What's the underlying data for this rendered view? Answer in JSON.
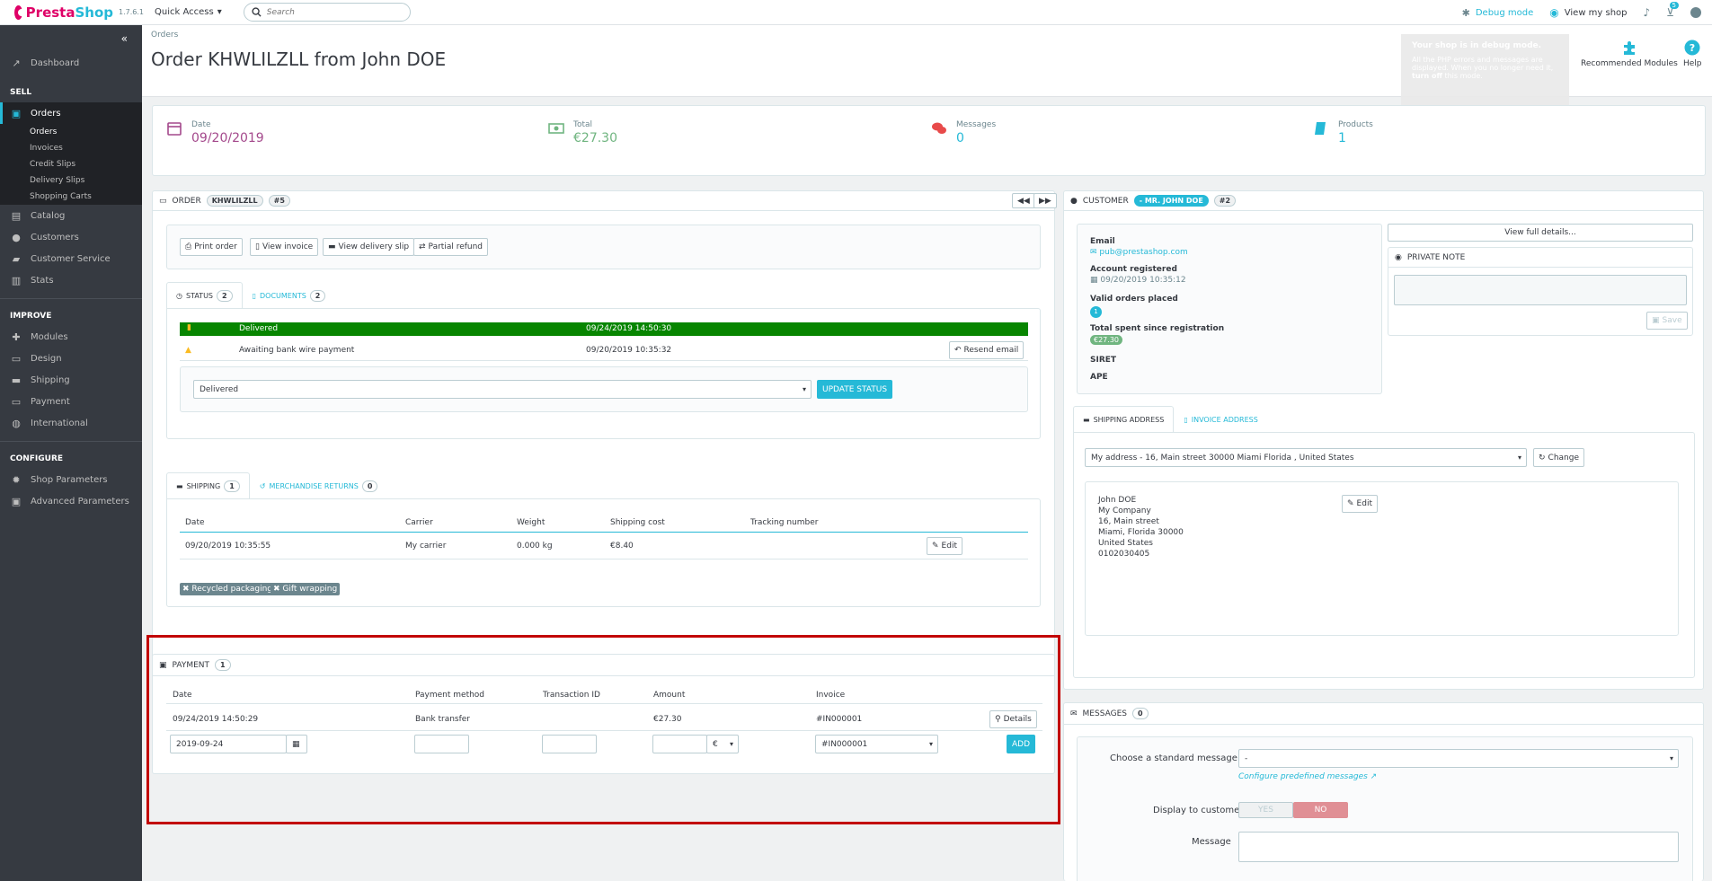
{
  "app": {
    "brand_pre": "Presta",
    "brand_post": "Shop",
    "version": "1.7.6.1",
    "quick_access": "Quick Access",
    "search_placeholder": "Search"
  },
  "topnav": {
    "debug_mode": "Debug mode",
    "view_shop": "View my shop",
    "notif_count": "5"
  },
  "debug_popup": {
    "title": "Your shop is in debug mode.",
    "body": "All the PHP errors and messages are displayed. When you no longer need it, ",
    "turn_off": "turn off",
    "body_end": " this mode."
  },
  "toolbar": {
    "recommended": "Recommended Modules",
    "help": "Help"
  },
  "sidebar": {
    "dashboard": "Dashboard",
    "sell": "SELL",
    "orders": "Orders",
    "sub": [
      "Orders",
      "Invoices",
      "Credit Slips",
      "Delivery Slips",
      "Shopping Carts"
    ],
    "catalog": "Catalog",
    "customers": "Customers",
    "customer_service": "Customer Service",
    "stats": "Stats",
    "improve": "IMPROVE",
    "modules": "Modules",
    "design": "Design",
    "shipping": "Shipping",
    "payment": "Payment",
    "international": "International",
    "configure": "CONFIGURE",
    "shop_params": "Shop Parameters",
    "adv_params": "Advanced Parameters"
  },
  "page": {
    "breadcrumb": "Orders",
    "title": "Order KHWLILZLL from John DOE"
  },
  "kpis": {
    "date_label": "Date",
    "date_value": "09/20/2019",
    "total_label": "Total",
    "total_value": "€27.30",
    "messages_label": "Messages",
    "messages_value": "0",
    "products_label": "Products",
    "products_value": "1"
  },
  "order": {
    "label": "ORDER",
    "reference": "KHWLILZLL",
    "id": "#5",
    "print": "Print order",
    "view_invoice": "View invoice",
    "view_delivery": "View delivery slip",
    "partial_refund": "Partial refund",
    "tab_status": "STATUS",
    "tab_status_count": "2",
    "tab_documents": "DOCUMENTS",
    "tab_documents_count": "2",
    "status_rows": [
      {
        "name": "Delivered",
        "date": "09/24/2019 14:50:30"
      },
      {
        "name": "Awaiting bank wire payment",
        "date": "09/20/2019 10:35:32"
      }
    ],
    "resend_email": "Resend email",
    "status_select": "Delivered",
    "update_status": "UPDATE STATUS",
    "tab_shipping": "SHIPPING",
    "tab_shipping_count": "1",
    "tab_returns": "MERCHANDISE RETURNS",
    "tab_returns_count": "0",
    "ship_headers": [
      "Date",
      "Carrier",
      "Weight",
      "Shipping cost",
      "Tracking number"
    ],
    "ship_row": [
      "09/20/2019 10:35:55",
      "My carrier",
      "0.000 kg",
      "€8.40"
    ],
    "edit": "Edit",
    "recycled": "Recycled packaging",
    "gift": "Gift wrapping"
  },
  "payment": {
    "label": "PAYMENT",
    "count": "1",
    "headers": [
      "Date",
      "Payment method",
      "Transaction ID",
      "Amount",
      "Invoice"
    ],
    "row": [
      "09/24/2019 14:50:29",
      "Bank transfer",
      "",
      "€27.30",
      "#IN000001"
    ],
    "details": "Details",
    "new_date": "2019-09-24",
    "currency": "€",
    "invoice_select": "#IN000001",
    "add": "ADD"
  },
  "customer": {
    "label": "CUSTOMER",
    "name": "- MR. JOHN DOE",
    "id": "#2",
    "email_label": "Email",
    "email": "pub@prestashop.com",
    "registered_label": "Account registered",
    "registered": "09/20/2019 10:35:12",
    "valid_orders_label": "Valid orders placed",
    "valid_orders": "1",
    "total_spent_label": "Total spent since registration",
    "total_spent": "€27.30",
    "siret": "SIRET",
    "ape": "APE",
    "view_full": "View full details...",
    "private_note": "PRIVATE NOTE",
    "save": "Save",
    "tab_shipping_addr": "SHIPPING ADDRESS",
    "tab_invoice_addr": "INVOICE ADDRESS",
    "address_select": "My address - 16, Main street 30000 Miami Florida , United States",
    "change": "Change",
    "address_lines": [
      "John DOE",
      "My Company",
      "16, Main street",
      "Miami, Florida 30000",
      "United States",
      "0102030405"
    ],
    "edit": "Edit"
  },
  "messages": {
    "label": "MESSAGES",
    "count": "0",
    "choose_label": "Choose a standard message",
    "choose_value": "-",
    "configure_link": "Configure predefined messages",
    "display_label": "Display to customer?",
    "yes": "YES",
    "no": "NO",
    "message_label": "Message"
  },
  "colors": {
    "accent": "#25b9d7",
    "brand": "#df0067",
    "delivered": "#078500",
    "highlight": "#c20000",
    "sidebar": "#363a41"
  }
}
